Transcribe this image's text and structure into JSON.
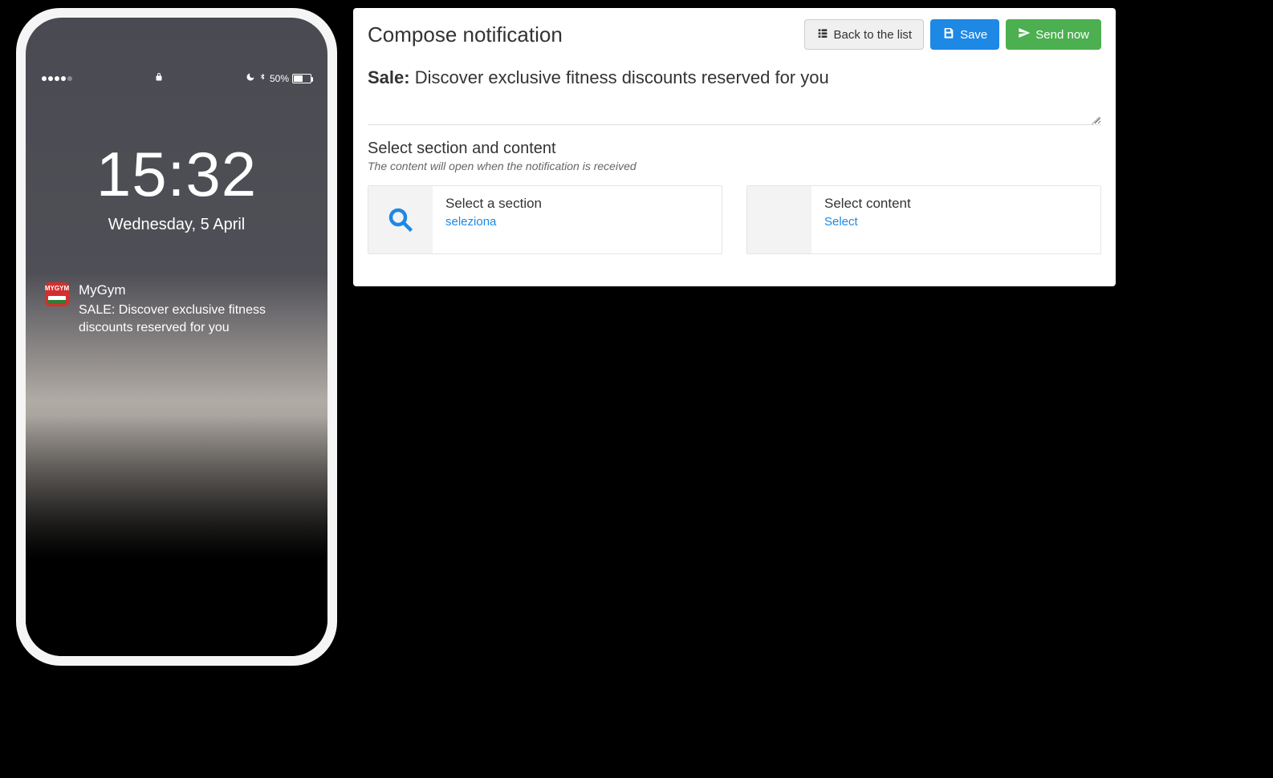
{
  "phone": {
    "status": {
      "battery_pct": "50%",
      "lock_icon": "lock"
    },
    "clock": {
      "time": "15:32",
      "date": "Wednesday, 5 April"
    },
    "notification": {
      "app_icon_text": "MYGYM",
      "app_name": "MyGym",
      "body": "SALE: Discover exclusive fitness discounts reserved for you"
    }
  },
  "panel": {
    "title": "Compose notification",
    "buttons": {
      "back": "Back to the list",
      "save": "Save",
      "send": "Send now"
    },
    "message": {
      "prefix": "Sale:",
      "text": "Discover exclusive fitness discounts reserved for you"
    },
    "section": {
      "heading": "Select section and content",
      "help": "The content will open when the notification is received"
    },
    "pickers": {
      "section": {
        "label": "Select a section",
        "link": "seleziona"
      },
      "content": {
        "label": "Select content",
        "link": "Select"
      }
    }
  }
}
